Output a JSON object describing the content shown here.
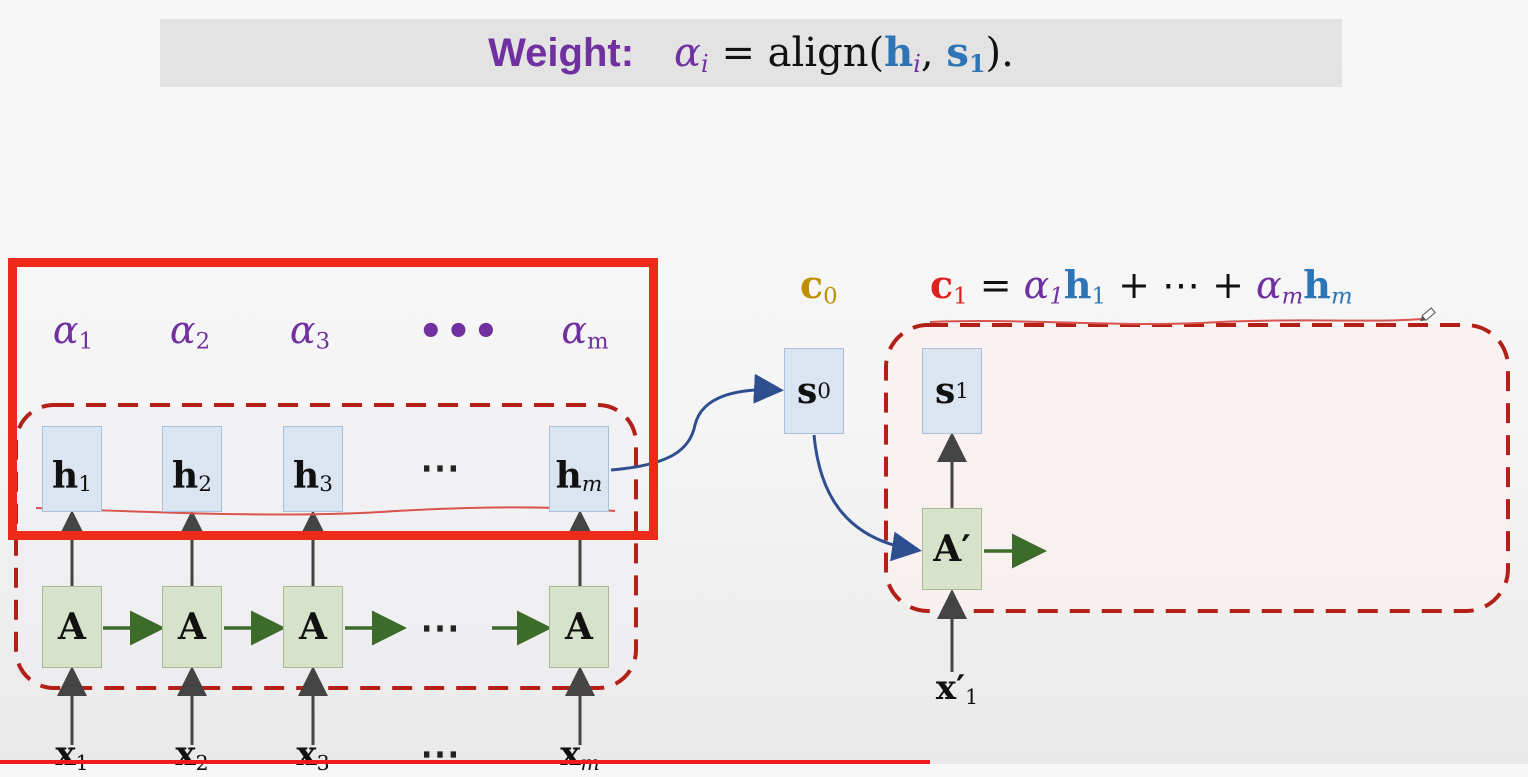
{
  "title": {
    "word": "Weight",
    "colon": ":",
    "alpha": "α",
    "i": "i",
    "equals_align": "= align(",
    "h": "h",
    "comma": ",",
    "s": "s",
    "one": "1",
    "close": ")."
  },
  "alphas": [
    {
      "sym": "α",
      "sub": "1"
    },
    {
      "sym": "α",
      "sub": "2"
    },
    {
      "sym": "α",
      "sub": "3"
    },
    {
      "sym": "α",
      "sub": "m"
    }
  ],
  "alpha_dots": "•••",
  "hidden_states": [
    {
      "sym": "h",
      "sub": "1"
    },
    {
      "sym": "h",
      "sub": "2"
    },
    {
      "sym": "h",
      "sub": "3"
    },
    {
      "sym": "h",
      "sub": "m"
    }
  ],
  "h_dots": "⋯",
  "encoder_cells": [
    "A",
    "A",
    "A",
    "A"
  ],
  "a_dots": "⋯",
  "inputs": [
    {
      "sym": "x",
      "sub": "1"
    },
    {
      "sym": "x",
      "sub": "2"
    },
    {
      "sym": "x",
      "sub": "3"
    },
    {
      "sym": "x",
      "sub": "m"
    }
  ],
  "x_dots": "⋯",
  "decoder": {
    "s0": {
      "sym": "s",
      "sub": "0"
    },
    "s1": {
      "sym": "s",
      "sub": "1"
    },
    "cell": "A′",
    "input": {
      "sym": "x′",
      "sub": "1"
    }
  },
  "context": {
    "c0": {
      "sym": "c",
      "sub": "0"
    },
    "c1": {
      "sym": "c",
      "sub": "1"
    },
    "equals": " = ",
    "alpha": "α",
    "one": "1",
    "h": "h",
    "plus_dots": " + ⋯ + ",
    "m": "m"
  },
  "colors": {
    "purple": "#7030a0",
    "blue": "#2e75b6",
    "red": "#e0201c",
    "gold": "#bf9000",
    "highlight_frame": "#ee2a1b",
    "dashed_border": "#b22018",
    "green_arrow": "#3d6b2a",
    "blue_arrow": "#2e4f8f"
  }
}
